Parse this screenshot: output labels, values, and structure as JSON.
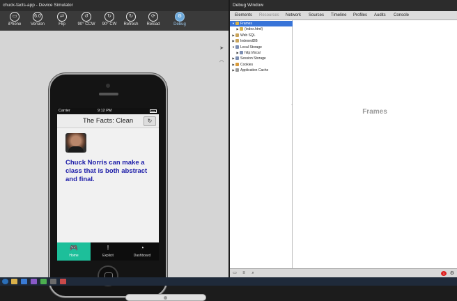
{
  "simulator": {
    "title": "chuck-facts-app - Device Simulator",
    "toolbar": [
      {
        "label": "iPhone",
        "icon": "device-icon",
        "glyph": "▭"
      },
      {
        "label": "Version",
        "icon": "version-icon",
        "glyph": "6.0"
      },
      {
        "label": "Flip",
        "icon": "flip-icon",
        "glyph": "⇄"
      },
      {
        "label": "90° CCW",
        "icon": "rotate-ccw-icon",
        "glyph": "↺"
      },
      {
        "label": "90° CW",
        "icon": "rotate-cw-icon",
        "glyph": "↻"
      },
      {
        "label": "Refresh",
        "icon": "refresh-icon",
        "glyph": "↻"
      },
      {
        "label": "Reload",
        "icon": "reload-icon",
        "glyph": "⟳"
      },
      {
        "label": "Debug",
        "icon": "debug-icon",
        "glyph": "⚙"
      }
    ],
    "phone": {
      "carrier": "Carrier",
      "time": "9:12 PM",
      "app_title": "The Facts: Clean",
      "fact": "Chuck Norris can make a class that is both abstract and final.",
      "tabs": [
        {
          "label": "Home",
          "icon": "gamepad-icon",
          "glyph": "🎮"
        },
        {
          "label": "Explicit",
          "icon": "exclamation-icon",
          "glyph": "!"
        },
        {
          "label": "Dashboard",
          "icon": "dashboard-icon",
          "glyph": "◔"
        }
      ]
    }
  },
  "debug": {
    "title": "Debug Window",
    "tabs": [
      "Elements",
      "Resources",
      "Network",
      "Sources",
      "Timeline",
      "Profiles",
      "Audits",
      "Console"
    ],
    "active_tab": "Resources",
    "tree": [
      {
        "label": "Frames",
        "level": 0,
        "selected": true,
        "expanded": true,
        "icon_color": "#d8b24a"
      },
      {
        "label": "(index.html)",
        "level": 1,
        "selected": false,
        "expanded": false,
        "icon_color": "#d8b24a"
      },
      {
        "label": "Web SQL",
        "level": 0,
        "selected": false,
        "expanded": false,
        "icon_color": "#c9a45a"
      },
      {
        "label": "IndexedDB",
        "level": 0,
        "selected": false,
        "expanded": false,
        "icon_color": "#c9a45a"
      },
      {
        "label": "Local Storage",
        "level": 0,
        "selected": false,
        "expanded": true,
        "icon_color": "#7d8fb3"
      },
      {
        "label": "http://local",
        "level": 1,
        "selected": false,
        "expanded": false,
        "icon_color": "#7d8fb3"
      },
      {
        "label": "Session Storage",
        "level": 0,
        "selected": false,
        "expanded": false,
        "icon_color": "#7d8fb3"
      },
      {
        "label": "Cookies",
        "level": 0,
        "selected": false,
        "expanded": false,
        "icon_color": "#d89a3a"
      },
      {
        "label": "Application Cache",
        "level": 0,
        "selected": false,
        "expanded": false,
        "icon_color": "#9a9a9a"
      }
    ],
    "frames_label": "Frames",
    "error_count": "1"
  },
  "colors": {
    "tab_active": "#1dbf9a",
    "fact_text": "#1b1ba8",
    "tree_selected": "#3874d8"
  }
}
